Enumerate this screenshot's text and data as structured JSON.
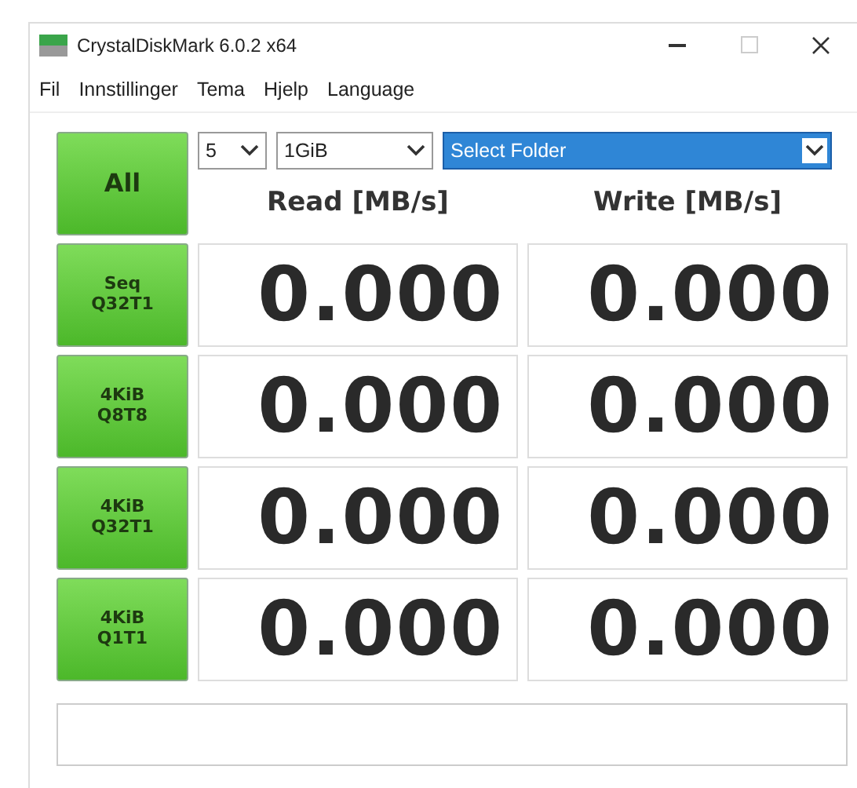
{
  "window": {
    "title": "CrystalDiskMark 6.0.2 x64"
  },
  "menu": [
    "Fil",
    "Innstillinger",
    "Tema",
    "Hjelp",
    "Language"
  ],
  "all_button": "All",
  "count_select": {
    "value": "5"
  },
  "size_select": {
    "value": "1GiB"
  },
  "folder_select": {
    "value": "Select Folder",
    "selected": true
  },
  "headers": {
    "read": "Read [MB/s]",
    "write": "Write [MB/s]"
  },
  "rows": [
    {
      "test": [
        "Seq",
        "Q32T1"
      ],
      "read": "0.000",
      "write": "0.000"
    },
    {
      "test": [
        "4KiB",
        "Q8T8"
      ],
      "read": "0.000",
      "write": "0.000"
    },
    {
      "test": [
        "4KiB",
        "Q32T1"
      ],
      "read": "0.000",
      "write": "0.000"
    },
    {
      "test": [
        "4KiB",
        "Q1T1"
      ],
      "read": "0.000",
      "write": "0.000"
    }
  ]
}
